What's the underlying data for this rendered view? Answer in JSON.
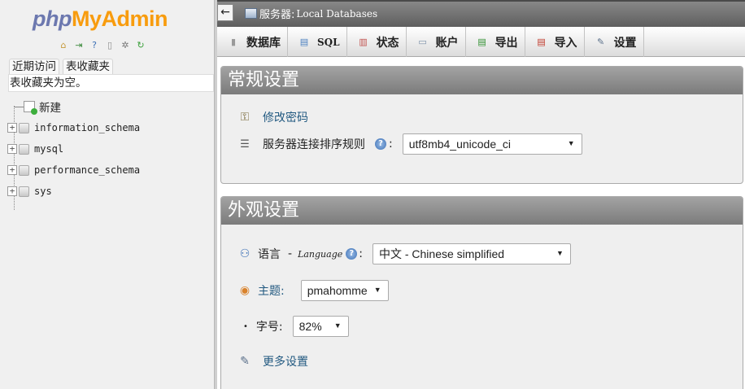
{
  "nav": {
    "logo": {
      "php": "php",
      "my": "My",
      "admin": "Admin"
    },
    "links": [
      {
        "name": "home-icon",
        "glyph": "⌂",
        "color": "#c69a3a"
      },
      {
        "name": "logout-icon",
        "glyph": "⇥",
        "color": "#3a8a3a"
      },
      {
        "name": "help-icon",
        "glyph": "?",
        "color": "#3b6fb5"
      },
      {
        "name": "docs-icon",
        "glyph": "▯",
        "color": "#8c8c8c"
      },
      {
        "name": "settings-icon",
        "glyph": "✲",
        "color": "#777777"
      },
      {
        "name": "reload-icon",
        "glyph": "↻",
        "color": "#3aa03a"
      }
    ],
    "tabs": {
      "recent": "近期访问",
      "favorites": "表收藏夹"
    },
    "favorites_empty": "表收藏夹为空。",
    "new_label": "新建",
    "databases": [
      "information_schema",
      "mysql",
      "performance_schema",
      "sys"
    ]
  },
  "topbar": {
    "collapse_glyph": "←",
    "server_label": "服务器:",
    "server_value": "Local Databases"
  },
  "menu": [
    {
      "id": "databases",
      "label": "数据库",
      "icon": "▮",
      "color": "#9a9a9a"
    },
    {
      "id": "sql",
      "label": "SQL",
      "icon": "▤",
      "color": "#4a7fc0"
    },
    {
      "id": "status",
      "label": "状态",
      "icon": "▥",
      "color": "#c0504d"
    },
    {
      "id": "accounts",
      "label": "账户",
      "icon": "▭",
      "color": "#7a8fa8"
    },
    {
      "id": "export",
      "label": "导出",
      "icon": "▤",
      "color": "#2f8f2f"
    },
    {
      "id": "import",
      "label": "导入",
      "icon": "▤",
      "color": "#c0392b"
    },
    {
      "id": "settings",
      "label": "设置",
      "icon": "✎",
      "color": "#5a6f8a"
    }
  ],
  "general": {
    "title": "常规设置",
    "change_password": "修改密码",
    "collation_label": "服务器连接排序规则",
    "collation_value": "utf8mb4_unicode_ci"
  },
  "appearance": {
    "title": "外观设置",
    "language_label": "语言",
    "language_sep": "-",
    "language_en": "Language",
    "language_value": "中文 - Chinese simplified",
    "theme_label": "主题:",
    "theme_value": "pmahomme",
    "fontsize_label": "字号:",
    "fontsize_value": "82%",
    "more_settings": "更多设置"
  }
}
